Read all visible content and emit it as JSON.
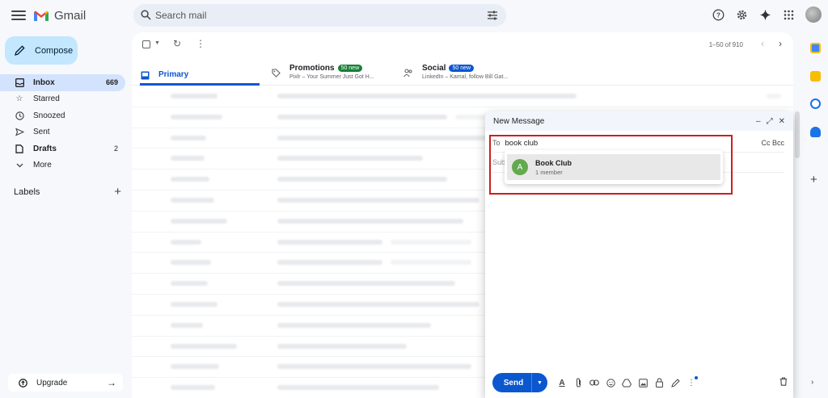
{
  "app": {
    "name": "Gmail",
    "search_placeholder": "Search mail"
  },
  "header_icons": [
    "help-icon",
    "settings-icon",
    "gemini-icon",
    "apps-icon",
    "account-avatar"
  ],
  "sidebar": {
    "compose_label": "Compose",
    "items": [
      {
        "label": "Inbox",
        "count": "669",
        "icon": "inbox-icon",
        "active": true
      },
      {
        "label": "Starred",
        "count": "",
        "icon": "star-icon"
      },
      {
        "label": "Snoozed",
        "count": "",
        "icon": "clock-icon"
      },
      {
        "label": "Sent",
        "count": "",
        "icon": "send-icon"
      },
      {
        "label": "Drafts",
        "count": "2",
        "icon": "draft-icon",
        "bold": true
      },
      {
        "label": "More",
        "count": "",
        "icon": "chevron-down-icon"
      }
    ],
    "labels_heading": "Labels",
    "upgrade_label": "Upgrade"
  },
  "toolbar": {
    "pager": "1–50 of 910"
  },
  "tabs": {
    "primary": {
      "label": "Primary"
    },
    "promotions": {
      "label": "Promotions",
      "badge": "50 new",
      "badge_color": "#188038",
      "preview": "Pixlr – Your Summer Just Got H..."
    },
    "social": {
      "label": "Social",
      "badge": "50 new",
      "badge_color": "#0b57d0",
      "preview": "LinkedIn – Kamal, follow Bill Gat..."
    }
  },
  "compose_window": {
    "title": "New Message",
    "to_label": "To",
    "to_value": "book club",
    "cc_bcc": "Cc Bcc",
    "subject_label": "Sub",
    "suggestion": {
      "avatar_letter": "A",
      "name": "Book Club",
      "detail": "1 member"
    },
    "send_label": "Send"
  },
  "colors": {
    "accent": "#0b57d0",
    "compose_bg": "#c2e7ff",
    "active_nav": "#d3e3fd",
    "highlight_box": "#cc1f1f",
    "suggestion_avatar": "#63a94f"
  }
}
